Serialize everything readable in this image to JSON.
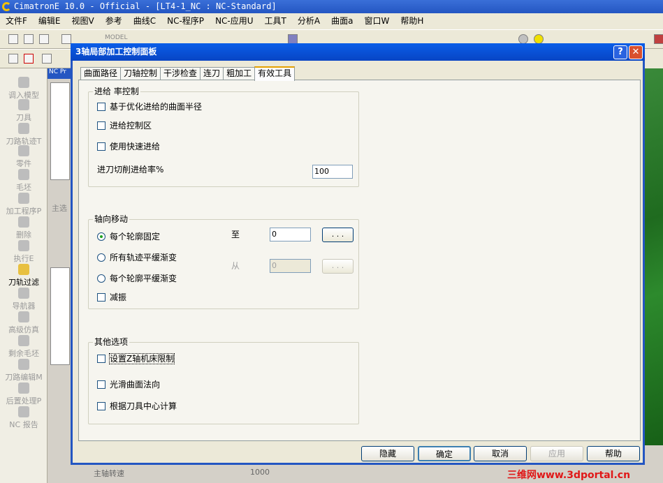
{
  "app": {
    "title": "CimatronE 10.0 - Official - [LT4-1_NC : NC-Standard]"
  },
  "menu": [
    "文件F",
    "编辑E",
    "视图V",
    "参考",
    "曲线C",
    "NC-程序P",
    "NC-应用U",
    "工具T",
    "分析A",
    "曲面a",
    "窗口W",
    "帮助H"
  ],
  "toolbar": {
    "model_combo": "MODEL"
  },
  "sidebar": [
    "调入模型",
    "刀具",
    "刀路轨迹T",
    "零件",
    "毛坯",
    "加工程序P",
    "删除",
    "执行E",
    "刀轨过滤",
    "导航器",
    "高级仿真",
    "剩余毛坯",
    "刀路编辑M",
    "后置处理P",
    "NC 报告"
  ],
  "nc_panel": {
    "tab": "NC Pr",
    "label": "主选",
    "prop_name": "主轴转速",
    "prop_value": "1000"
  },
  "dialog": {
    "title": "3轴局部加工控制面板",
    "help_btn": "?",
    "close_btn": "✕",
    "tabs": [
      "曲面路径",
      "刀轴控制",
      "干涉检查",
      "连刀",
      "粗加工",
      "有效工具"
    ],
    "selected_tab": "有效工具",
    "feed_group": {
      "label": "进给 率控制",
      "opt1": "基于优化进给的曲面半径",
      "opt2": "进给控制区",
      "opt3": "使用快速进给",
      "rate_label": "进刀切削进给率%",
      "rate_value": "100"
    },
    "axial_group": {
      "label": "轴向移动",
      "opt1": "每个轮廓固定",
      "opt2": "所有轨迹平缓渐变",
      "opt3": "每个轮廓平缓渐变",
      "opt4": "减振",
      "to_label": "至",
      "to_value": "0",
      "from_label": "从",
      "from_value": "0",
      "ellipsis": ". . ."
    },
    "other_group": {
      "label": "其他选项",
      "opt1": "设置Z轴机床限制",
      "opt2": "光滑曲面法向",
      "opt3": "根据刀具中心计算"
    },
    "buttons": {
      "hide": "隐藏",
      "ok": "确定",
      "cancel": "取消",
      "apply": "应用",
      "help": "帮助"
    }
  },
  "watermark": "三维网www.3dportal.cn"
}
